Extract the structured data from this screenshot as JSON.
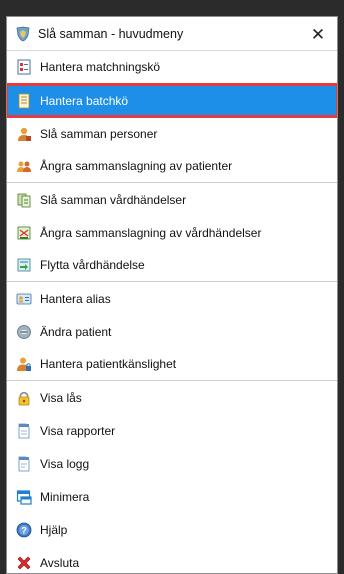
{
  "window": {
    "title": "Slå samman - huvudmeny",
    "close_glyph": "✕"
  },
  "menu": {
    "items": [
      {
        "label": "Hantera matchningskö",
        "icon": "checklist-icon"
      },
      {
        "label": "Hantera batchkö",
        "icon": "document-list-icon",
        "selected": true
      },
      {
        "label": "Slå samman personer",
        "icon": "person-icon"
      },
      {
        "label": "Ångra sammanslagning av patienter",
        "icon": "people-icon"
      },
      {
        "label": "Slå samman vårdhändelser",
        "icon": "merge-documents-icon"
      },
      {
        "label": "Ångra sammanslagning av vårdhändelser",
        "icon": "unmerge-documents-icon"
      },
      {
        "label": "Flytta vårdhändelse",
        "icon": "move-document-icon"
      },
      {
        "label": "Hantera alias",
        "icon": "id-card-icon"
      },
      {
        "label": "Ändra patient",
        "icon": "edit-patient-icon"
      },
      {
        "label": "Hantera patientkänslighet",
        "icon": "person-lock-icon"
      },
      {
        "label": "Visa lås",
        "icon": "padlock-icon"
      },
      {
        "label": "Visa rapporter",
        "icon": "document-icon"
      },
      {
        "label": "Visa logg",
        "icon": "log-document-icon"
      },
      {
        "label": "Minimera",
        "icon": "minimize-window-icon"
      },
      {
        "label": "Hjälp",
        "icon": "help-icon"
      },
      {
        "label": "Avsluta",
        "icon": "red-x-icon"
      }
    ]
  },
  "colors": {
    "selection": "#1e8fe8",
    "selection_outline": "#e8393f"
  }
}
